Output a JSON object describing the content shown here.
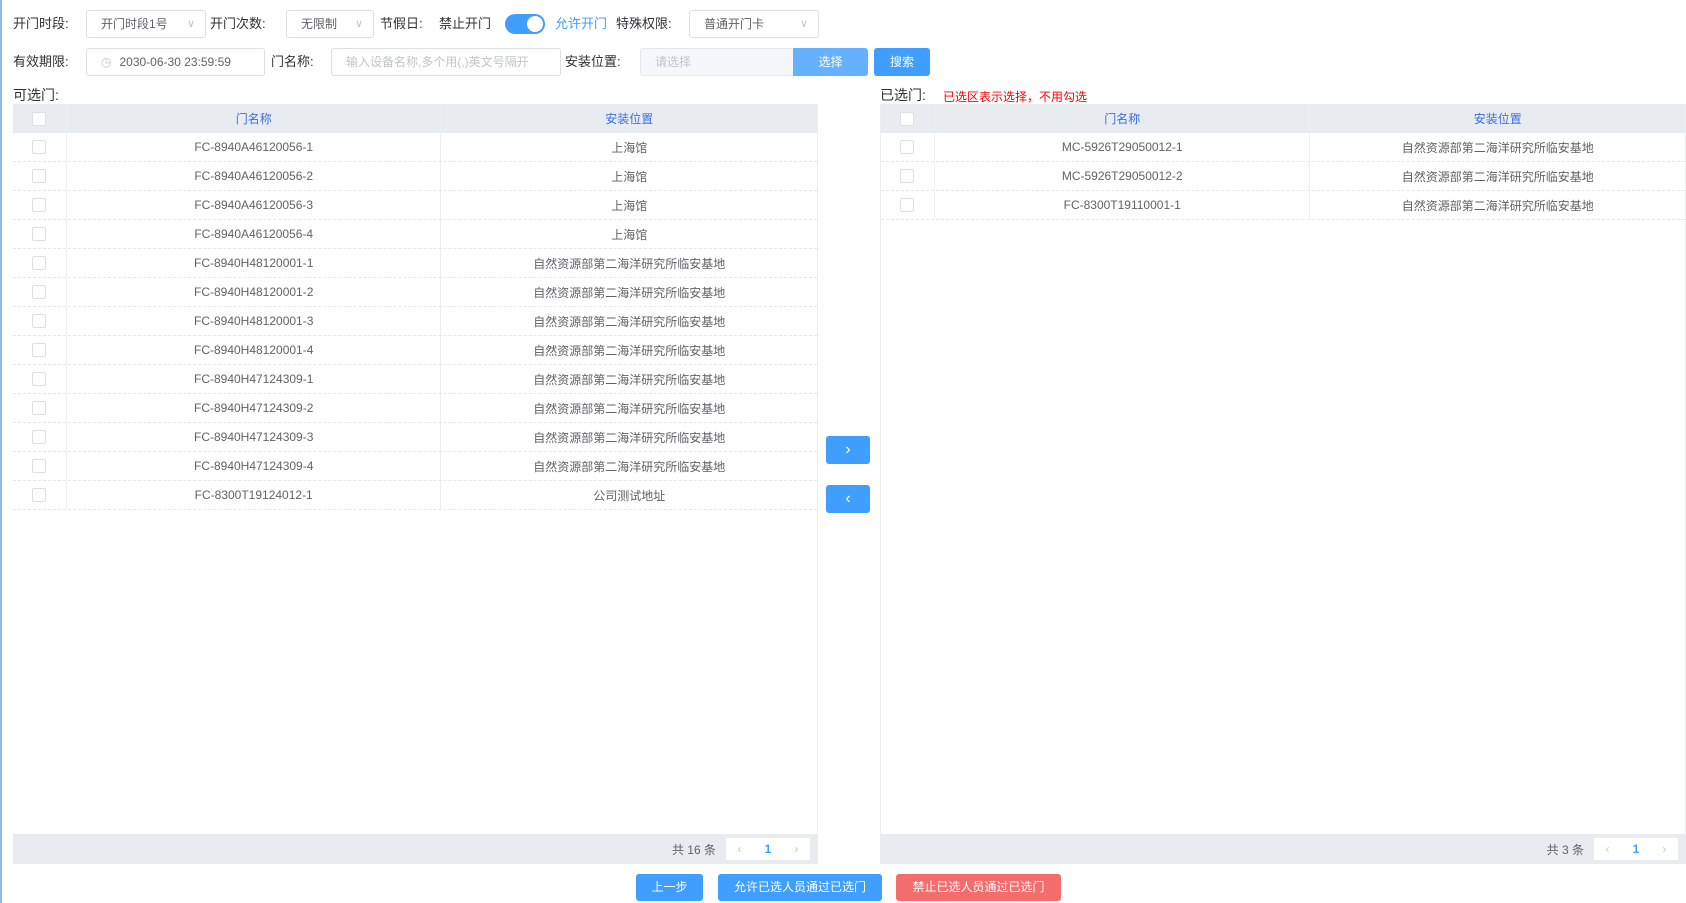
{
  "filters": {
    "period_label": "开门时段:",
    "period_value": "开门时段1号",
    "count_label": "开门次数:",
    "count_value": "无限制",
    "holiday_label": "节假日:",
    "holiday_off": "禁止开门",
    "holiday_on": "允许开门",
    "holiday_allowed": true,
    "special_label": "特殊权限:",
    "special_value": "普通开门卡",
    "expiry_label": "有效期限:",
    "expiry_value": "2030-06-30 23:59:59",
    "name_label": "门名称:",
    "name_placeholder": "输入设备名称,多个用(,)英文号隔开",
    "location_label": "安装位置:",
    "location_placeholder": "请选择",
    "choose_button": "选择",
    "search_button": "搜索"
  },
  "available": {
    "title": "可选门:",
    "columns": [
      "门名称",
      "安装位置"
    ],
    "rows": [
      [
        "FC-8940A46120056-1",
        "上海馆"
      ],
      [
        "FC-8940A46120056-2",
        "上海馆"
      ],
      [
        "FC-8940A46120056-3",
        "上海馆"
      ],
      [
        "FC-8940A46120056-4",
        "上海馆"
      ],
      [
        "FC-8940H48120001-1",
        "自然资源部第二海洋研究所临安基地"
      ],
      [
        "FC-8940H48120001-2",
        "自然资源部第二海洋研究所临安基地"
      ],
      [
        "FC-8940H48120001-3",
        "自然资源部第二海洋研究所临安基地"
      ],
      [
        "FC-8940H48120001-4",
        "自然资源部第二海洋研究所临安基地"
      ],
      [
        "FC-8940H47124309-1",
        "自然资源部第二海洋研究所临安基地"
      ],
      [
        "FC-8940H47124309-2",
        "自然资源部第二海洋研究所临安基地"
      ],
      [
        "FC-8940H47124309-3",
        "自然资源部第二海洋研究所临安基地"
      ],
      [
        "FC-8940H47124309-4",
        "自然资源部第二海洋研究所临安基地"
      ],
      [
        "FC-8300T19124012-1",
        "公司测试地址"
      ]
    ],
    "total": "共 16 条",
    "page": "1"
  },
  "selected": {
    "title": "已选门:",
    "note": "已选区表示选择，不用勾选",
    "columns": [
      "门名称",
      "安装位置"
    ],
    "rows": [
      [
        "MC-5926T29050012-1",
        "自然资源部第二海洋研究所临安基地"
      ],
      [
        "MC-5926T29050012-2",
        "自然资源部第二海洋研究所临安基地"
      ],
      [
        "FC-8300T19110001-1",
        "自然资源部第二海洋研究所临安基地"
      ]
    ],
    "total": "共 3 条",
    "page": "1"
  },
  "transfer": {
    "right": "›",
    "left": "‹"
  },
  "actions": {
    "prev": "上一步",
    "allow": "允许已选人员通过已选门",
    "deny": "禁止已选人员通过已选门"
  },
  "colors": {
    "primary": "#409eff",
    "danger": "#f56c6c",
    "note": "#ff0000"
  }
}
